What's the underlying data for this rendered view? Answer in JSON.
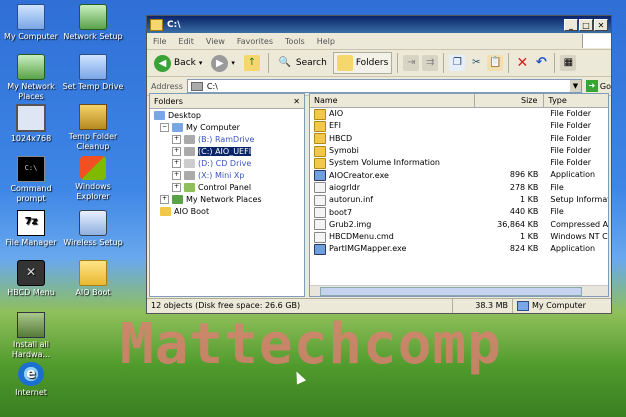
{
  "desktop": {
    "icons": [
      {
        "label": "My Computer",
        "icon": "my-computer-icon"
      },
      {
        "label": "Network Setup",
        "icon": "network-setup-icon"
      },
      {
        "label": "My Network Places",
        "icon": "network-places-icon"
      },
      {
        "label": "Set Temp Drive",
        "icon": "temp-drive-icon"
      },
      {
        "label": "1024x768",
        "icon": "monitor-icon"
      },
      {
        "label": "Temp Folder Cleanup",
        "icon": "cleanup-icon"
      },
      {
        "label": "Command prompt",
        "icon": "cmd-icon"
      },
      {
        "label": "Windows Explorer",
        "icon": "explorer-icon"
      },
      {
        "label": "File Manager",
        "icon": "7zip-icon"
      },
      {
        "label": "Wireless Setup",
        "icon": "wireless-icon"
      },
      {
        "label": "HBCD Menu",
        "icon": "hbcd-icon"
      },
      {
        "label": "AIO Boot",
        "icon": "folder-icon"
      },
      {
        "label": "Install all Hardwa...",
        "icon": "install-icon"
      },
      {
        "label": "Internet",
        "icon": "internet-icon"
      }
    ],
    "watermark": "Mattechcomp"
  },
  "window": {
    "title": "C:\\",
    "menu": [
      "File",
      "Edit",
      "View",
      "Favorites",
      "Tools",
      "Help"
    ],
    "toolbar": {
      "back": "Back",
      "search": "Search",
      "folders": "Folders"
    },
    "address": {
      "label": "Address",
      "value": "C:\\",
      "go": "Go"
    },
    "folders_pane": {
      "title": "Folders",
      "tree": [
        {
          "label": "Desktop"
        },
        {
          "label": "My Computer"
        },
        {
          "label": "(B:) RamDrive"
        },
        {
          "label": "(C:) AIO_UEFI"
        },
        {
          "label": "(D:) CD Drive"
        },
        {
          "label": "(X:) Mini Xp"
        },
        {
          "label": "Control Panel"
        },
        {
          "label": "My Network Places"
        },
        {
          "label": "AIO Boot"
        }
      ]
    },
    "files": {
      "columns": [
        "Name",
        "Size",
        "Type"
      ],
      "rows": [
        {
          "name": "AIO",
          "size": "",
          "type": "File Folder",
          "kind": "folder"
        },
        {
          "name": "EFI",
          "size": "",
          "type": "File Folder",
          "kind": "folder"
        },
        {
          "name": "HBCD",
          "size": "",
          "type": "File Folder",
          "kind": "folder"
        },
        {
          "name": "Symobi",
          "size": "",
          "type": "File Folder",
          "kind": "folder"
        },
        {
          "name": "System Volume Information",
          "size": "",
          "type": "File Folder",
          "kind": "folder"
        },
        {
          "name": "AIOCreator.exe",
          "size": "896 KB",
          "type": "Application",
          "kind": "app"
        },
        {
          "name": "aiogrldr",
          "size": "278 KB",
          "type": "File",
          "kind": "file"
        },
        {
          "name": "autorun.inf",
          "size": "1 KB",
          "type": "Setup Information",
          "kind": "file"
        },
        {
          "name": "boot7",
          "size": "440 KB",
          "type": "File",
          "kind": "file"
        },
        {
          "name": "Grub2.img",
          "size": "36,864 KB",
          "type": "Compressed Archive",
          "kind": "file"
        },
        {
          "name": "HBCDMenu.cmd",
          "size": "1 KB",
          "type": "Windows NT Command",
          "kind": "file"
        },
        {
          "name": "PartIMGMapper.exe",
          "size": "824 KB",
          "type": "Application",
          "kind": "app"
        }
      ]
    },
    "status": {
      "objects": "12 objects (Disk free space: 26.6 GB)",
      "size": "38.3 MB",
      "location": "My Computer"
    }
  }
}
